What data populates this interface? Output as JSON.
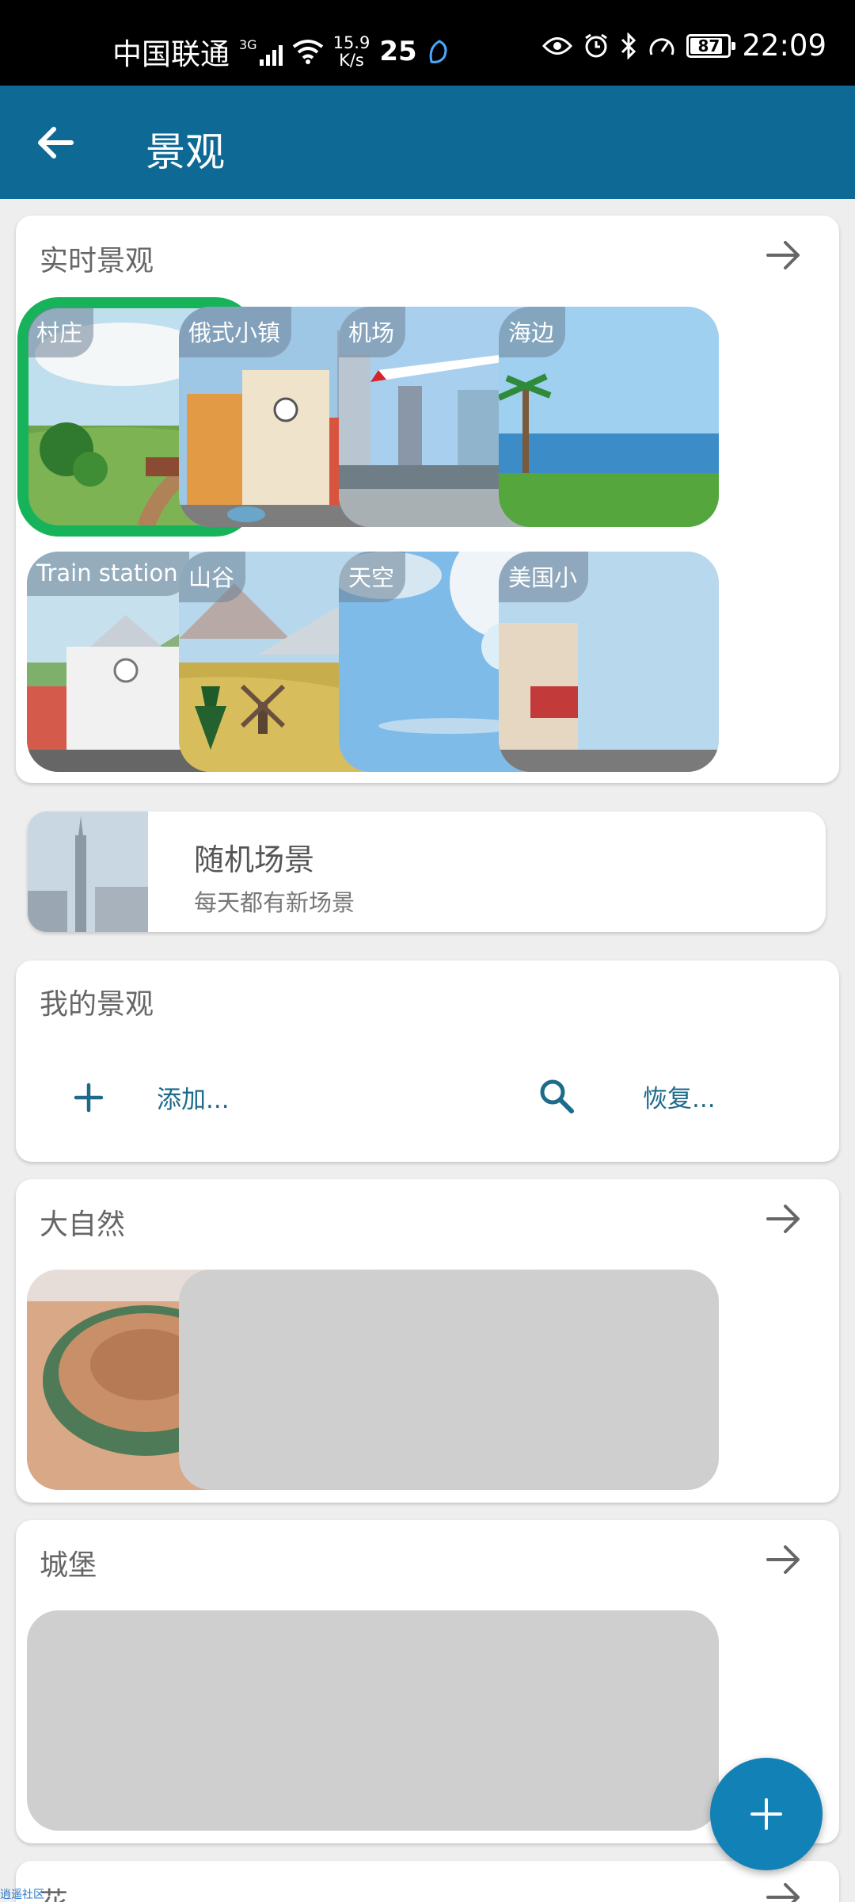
{
  "status_bar": {
    "carrier": "中国联通",
    "network_tag": "3G",
    "speed_value": "15.9",
    "speed_unit": "K/s",
    "temperature": "25",
    "battery": "87",
    "time": "22:09"
  },
  "app_bar": {
    "title": "景观"
  },
  "live_section": {
    "title": "实时景观",
    "items": [
      {
        "label": "村庄",
        "selected": true
      },
      {
        "label": "俄式小镇"
      },
      {
        "label": "机场"
      },
      {
        "label": "海边"
      },
      {
        "label": "Train station"
      },
      {
        "label": "山谷"
      },
      {
        "label": "天空"
      },
      {
        "label": "美国小"
      }
    ]
  },
  "random": {
    "title": "随机场景",
    "subtitle": "每天都有新场景"
  },
  "my_section": {
    "title": "我的景观",
    "add_label": "添加...",
    "restore_label": "恢复..."
  },
  "nature_section": {
    "title": "大自然"
  },
  "castle_section": {
    "title": "城堡"
  },
  "flower_section": {
    "title": "花"
  },
  "watermark": "逍遥社区",
  "colors": {
    "app_bar": "#0e6a94",
    "accent": "#1281b6",
    "selected_outline": "#16b35a"
  }
}
